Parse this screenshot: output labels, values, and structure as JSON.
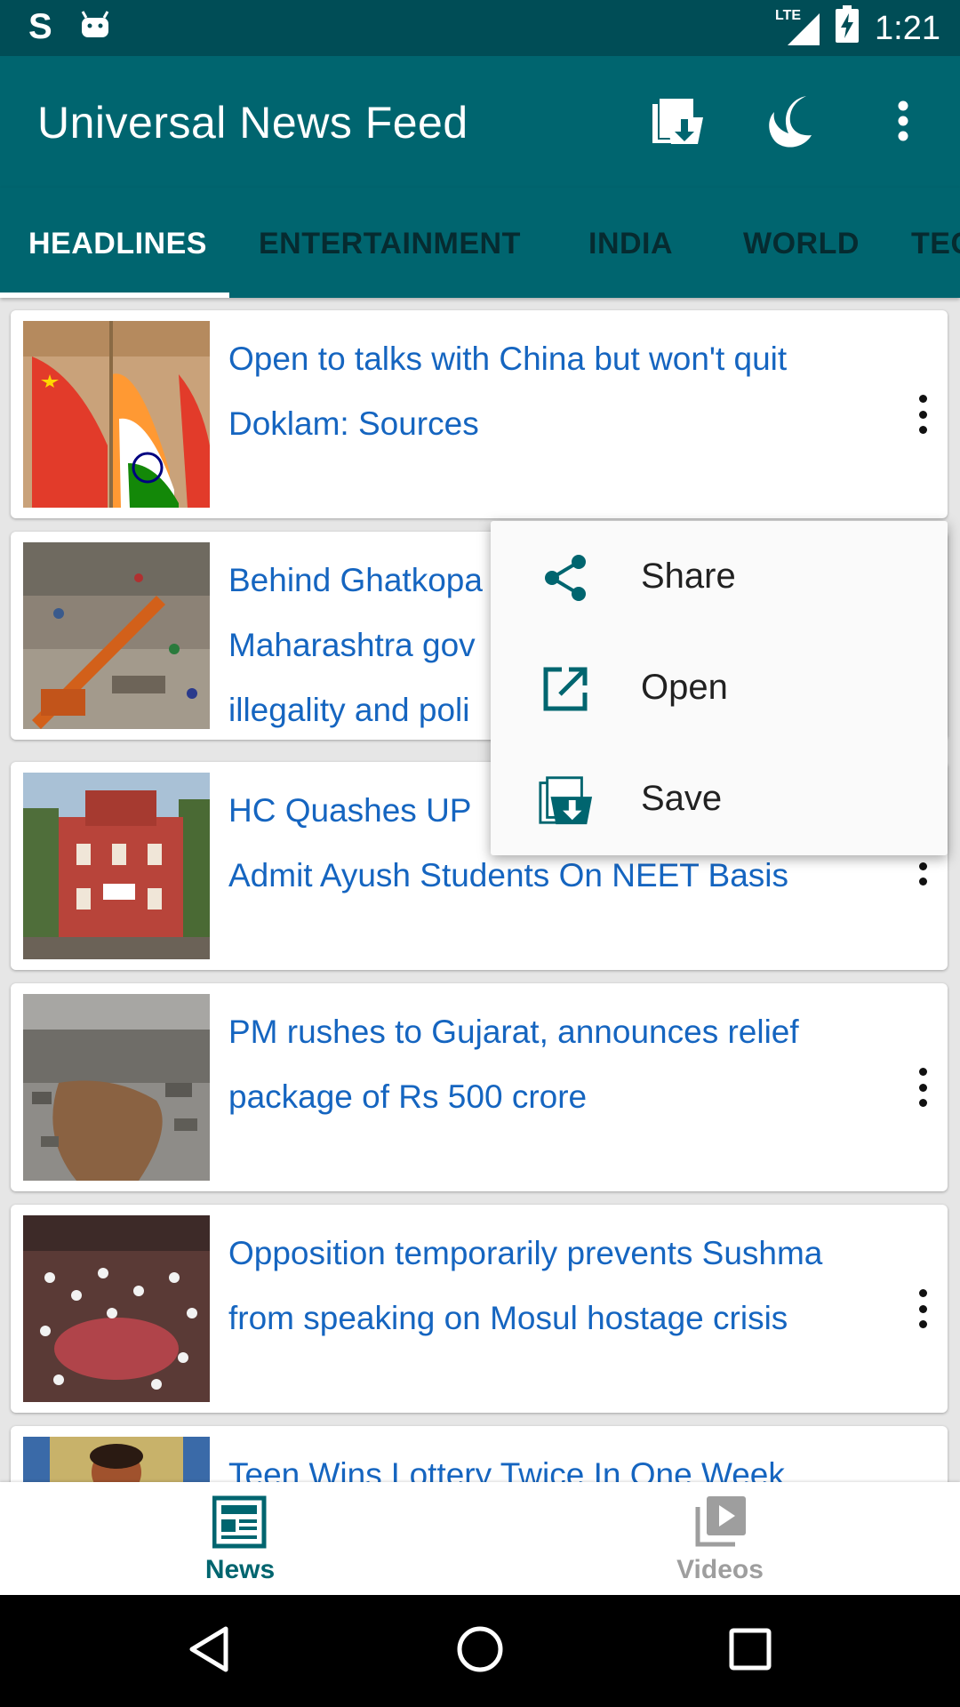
{
  "status_bar": {
    "carrier_letter": "S",
    "network": "LTE",
    "time": "1:21",
    "icons": [
      "android-icon",
      "signal-icon",
      "battery-charging-icon"
    ]
  },
  "app_bar": {
    "title": "Universal News Feed",
    "actions": [
      "saved-news-icon",
      "night-mode-icon",
      "overflow-menu-icon"
    ]
  },
  "tabs": [
    {
      "label": "HEADLINES",
      "active": true
    },
    {
      "label": "ENTERTAINMENT",
      "active": false
    },
    {
      "label": "INDIA",
      "active": false
    },
    {
      "label": "WORLD",
      "active": false
    },
    {
      "label": "TEC",
      "active": false
    }
  ],
  "articles": [
    {
      "headline": "Open to talks with China but won't quit Doklam: Sources",
      "thumbnail": "flags-photo"
    },
    {
      "headline": "Behind Ghatkopa",
      "thumbnail": "collapsed-building-photo"
    },
    {
      "headline": "HC Quashes UP",
      "thumbnail": "red-building-photo"
    },
    {
      "headline": "PM rushes to Gujarat, announces relief package of Rs 500 crore",
      "thumbnail": "flood-aerial-photo"
    },
    {
      "headline": "Opposition temporarily prevents Sushma from speaking on Mosul hostage crisis",
      "thumbnail": "parliament-photo"
    },
    {
      "headline": "Teen Wins Lottery Twice In One Week,",
      "thumbnail": "girl-photo"
    }
  ],
  "article_partial_lines": {
    "a2_line2": "Maharashtra gov",
    "a2_line3": "illegality and poli",
    "a3_line2": "Admit Ayush Students On NEET Basis"
  },
  "popup_menu": {
    "items": [
      {
        "label": "Share",
        "icon": "share-icon"
      },
      {
        "label": "Open",
        "icon": "open-external-icon"
      },
      {
        "label": "Save",
        "icon": "save-icon"
      }
    ]
  },
  "bottom_nav": {
    "items": [
      {
        "label": "News",
        "icon": "newspaper-icon",
        "active": true
      },
      {
        "label": "Videos",
        "icon": "video-library-icon",
        "active": false
      }
    ]
  },
  "colors": {
    "status_bar": "#004d56",
    "app_bar": "#00656f",
    "headline_link": "#1565c0",
    "active_nav": "#00656f",
    "inactive_nav": "#9e9e9e"
  }
}
